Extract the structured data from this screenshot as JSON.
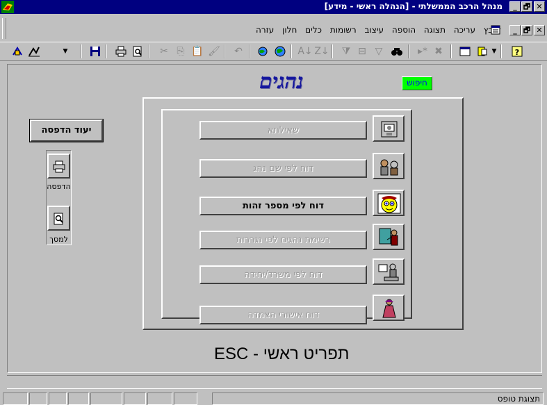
{
  "window": {
    "title": "מנהל הרכב הממשלתי - [הנהלה ראשי - מידע]",
    "minimize_label": "_",
    "maximize_label": "🗗",
    "close_label": "✕"
  },
  "menu": {
    "items": [
      "קובץ",
      "עריכה",
      "תצוגה",
      "הוספה",
      "עיצוב",
      "רשומות",
      "כלים",
      "חלון",
      "עזרה"
    ]
  },
  "toolbar": {
    "icons": [
      "help-icon",
      "new-object-icon",
      "database-window-icon",
      "delete-record-icon",
      "new-record-icon",
      "find-icon",
      "apply-filter-icon",
      "filter-by-form-icon",
      "filter-by-selection-icon",
      "sort-descending-icon",
      "sort-ascending-icon",
      "web-icon",
      "insert-hyperlink-icon",
      "undo-icon",
      "format-painter-icon",
      "paste-icon",
      "copy-icon",
      "cut-icon",
      "print-preview-icon",
      "print-icon",
      "save-icon",
      "view-icon",
      "design-icon"
    ]
  },
  "form": {
    "title": "נהגים",
    "search_label": "חיפוש",
    "print_setup_label": "יעוד הדפסה",
    "print_label": "הדפסה",
    "preview_label": "למסך",
    "esc_label": "תפריט ראשי - ESC",
    "reports": [
      {
        "label": "שאילתא",
        "icon": "query-icon",
        "enabled": false
      },
      {
        "label": "דוח לפי שם נהג",
        "icon": "people-icon",
        "enabled": false
      },
      {
        "label": "דוח לפי מספר זהות",
        "icon": "face-icon",
        "enabled": true
      },
      {
        "label": "רשימת נהגים לפי נגררות",
        "icon": "man-painting-icon",
        "enabled": false
      },
      {
        "label": "דוח לפי משרד/יחידה",
        "icon": "office-man-icon",
        "enabled": false
      },
      {
        "label": "דוח אישורי הצמדה",
        "icon": "woman-icon",
        "enabled": false
      }
    ]
  },
  "status": {
    "text": "תצוגת טופס"
  },
  "colors": {
    "titlebar": "#000080",
    "form_title": "#14169e",
    "search_bg": "#00ff00",
    "search_text": "#0000ff"
  }
}
